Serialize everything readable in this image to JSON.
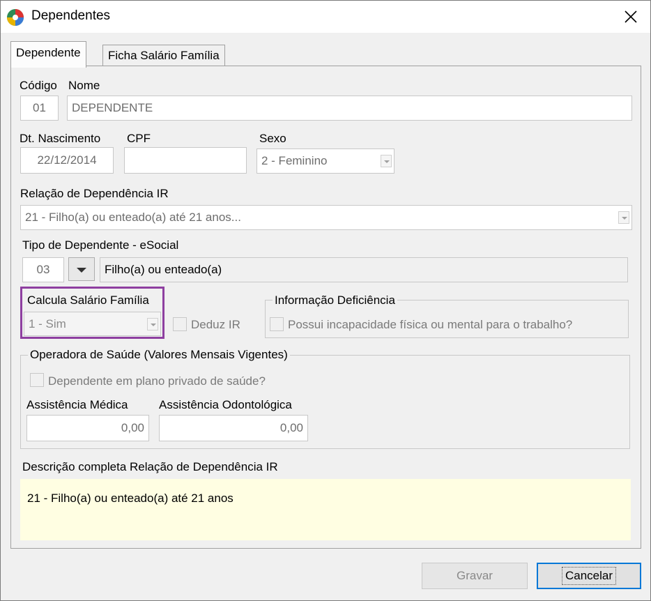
{
  "window": {
    "title": "Dependentes",
    "close_glyph": "✕"
  },
  "tabs": [
    "Dependente",
    "Ficha Salário Família"
  ],
  "labels": {
    "codigo": "Código",
    "nome": "Nome",
    "dt_nascimento": "Dt. Nascimento",
    "cpf": "CPF",
    "sexo": "Sexo",
    "relacao_ir": "Relação de Dependência IR",
    "tipo_esocial": "Tipo de Dependente - eSocial",
    "calcula_salario": "Calcula Salário Família",
    "deduz_ir": "Deduz IR",
    "info_deficiencia": "Informação Deficiência",
    "incapacidade": "Possui incapacidade física ou mental para o trabalho?",
    "operadora_saude": "Operadora de Saúde (Valores Mensais Vigentes)",
    "plano_privado": "Dependente em plano privado de saúde?",
    "assist_medica": "Assistência Médica",
    "assist_odonto": "Assistência Odontológica",
    "descricao": "Descrição completa Relação de Dependência IR"
  },
  "values": {
    "codigo": "01",
    "nome": "DEPENDENTE",
    "dt_nascimento": "22/12/2014",
    "cpf": "",
    "sexo": "2 - Feminino",
    "relacao_ir": "21 - Filho(a) ou enteado(a) até 21 anos...",
    "tipo_codigo": "03",
    "tipo_descricao": "Filho(a) ou enteado(a)",
    "calcula_salario": "1 - Sim",
    "assist_medica": "0,00",
    "assist_odonto": "0,00",
    "descricao": "21 - Filho(a) ou enteado(a) até 21 anos"
  },
  "buttons": {
    "gravar": "Gravar",
    "cancelar": "Cancelar"
  },
  "colors": {
    "highlight": "#8e3fa0",
    "description_bg": "#fffee2",
    "focus": "#0078d7"
  }
}
